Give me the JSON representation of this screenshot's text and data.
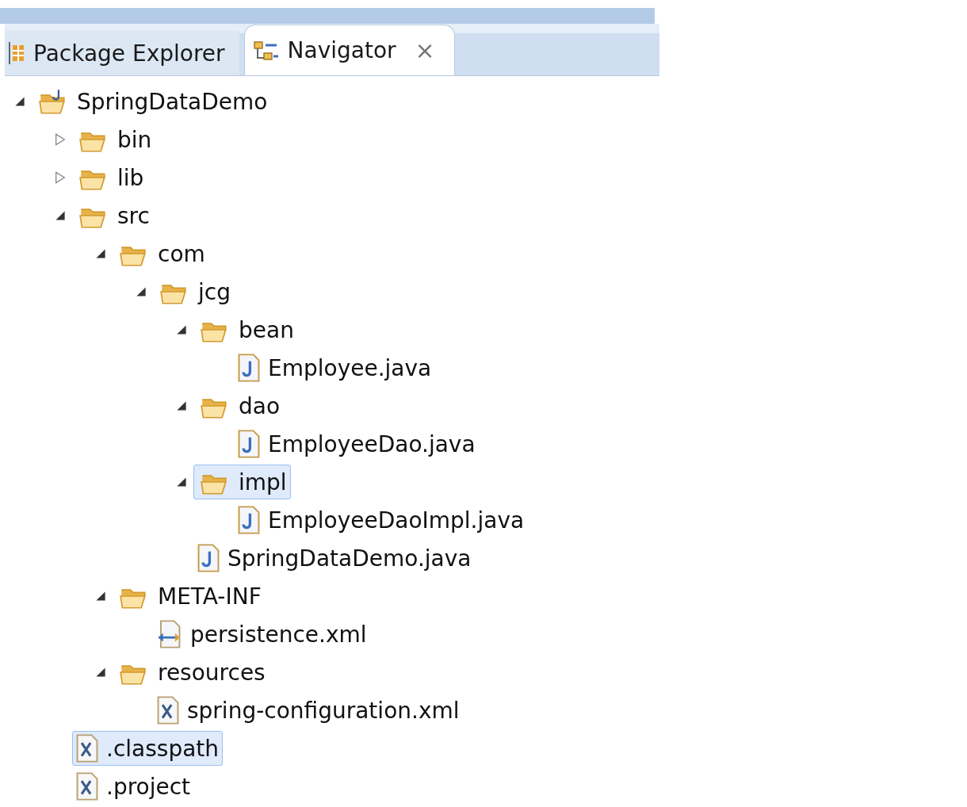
{
  "tabs": [
    {
      "label": "Package Explorer",
      "kind": "package",
      "selected": false
    },
    {
      "label": "Navigator",
      "kind": "navigator",
      "selected": true,
      "close": "×"
    }
  ],
  "tree": [
    {
      "label": "SpringDataDemo",
      "kind": "project",
      "expanded": true,
      "selected": false,
      "children": [
        {
          "label": "bin",
          "kind": "folder",
          "expanded": false,
          "selected": false
        },
        {
          "label": "lib",
          "kind": "folder",
          "expanded": false,
          "selected": false
        },
        {
          "label": "src",
          "kind": "folder",
          "expanded": true,
          "selected": false,
          "children": [
            {
              "label": "com",
              "kind": "folder",
              "expanded": true,
              "selected": false,
              "children": [
                {
                  "label": "jcg",
                  "kind": "folder",
                  "expanded": true,
                  "selected": false,
                  "children": [
                    {
                      "label": "bean",
                      "kind": "folder",
                      "expanded": true,
                      "selected": false,
                      "children": [
                        {
                          "label": "Employee.java",
                          "kind": "java",
                          "selected": false
                        }
                      ]
                    },
                    {
                      "label": "dao",
                      "kind": "folder",
                      "expanded": true,
                      "selected": false,
                      "children": [
                        {
                          "label": "EmployeeDao.java",
                          "kind": "java",
                          "selected": false
                        }
                      ]
                    },
                    {
                      "label": "impl",
                      "kind": "folder",
                      "expanded": true,
                      "selected": true,
                      "children": [
                        {
                          "label": "EmployeeDaoImpl.java",
                          "kind": "java",
                          "selected": false
                        }
                      ]
                    },
                    {
                      "label": "SpringDataDemo.java",
                      "kind": "java",
                      "selected": false
                    }
                  ]
                }
              ]
            },
            {
              "label": "META-INF",
              "kind": "folder",
              "expanded": true,
              "selected": false,
              "children": [
                {
                  "label": "persistence.xml",
                  "kind": "persistence",
                  "selected": false
                }
              ]
            },
            {
              "label": "resources",
              "kind": "folder",
              "expanded": true,
              "selected": false,
              "children": [
                {
                  "label": "spring-configuration.xml",
                  "kind": "xml",
                  "selected": false
                }
              ]
            }
          ]
        },
        {
          "label": ".classpath",
          "kind": "xml",
          "selected": true
        },
        {
          "label": ".project",
          "kind": "xml",
          "selected": false
        }
      ]
    }
  ]
}
